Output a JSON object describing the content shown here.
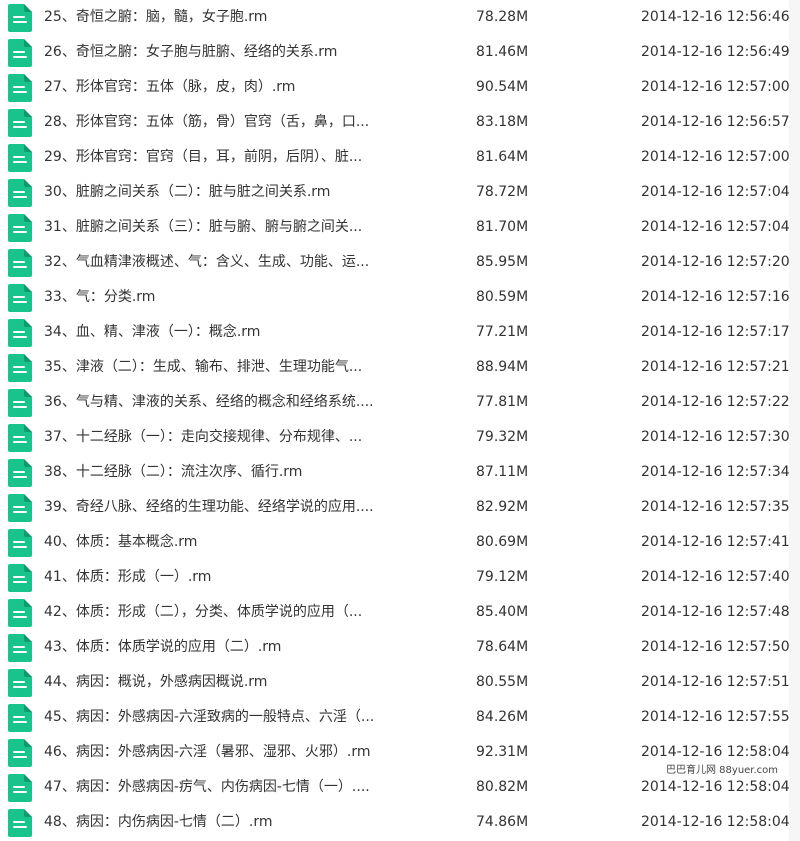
{
  "colors": {
    "file_icon": "#19c38c",
    "text": "#333333"
  },
  "file_icon_name": "document-icon",
  "files": [
    {
      "name": "25、奇恒之腑：脑，髓，女子胞.rm",
      "size": "78.28M",
      "date": "2014-12-16 12:56:46"
    },
    {
      "name": "26、奇恒之腑：女子胞与脏腑、经络的关系.rm",
      "size": "81.46M",
      "date": "2014-12-16 12:56:49"
    },
    {
      "name": "27、形体官窍：五体（脉，皮，肉）.rm",
      "size": "90.54M",
      "date": "2014-12-16 12:57:00"
    },
    {
      "name": "28、形体官窍：五体（筋，骨）官窍（舌，鼻，口...",
      "size": "83.18M",
      "date": "2014-12-16 12:56:57"
    },
    {
      "name": "29、形体官窍：官窍（目，耳，前阴，后阴）、脏...",
      "size": "81.64M",
      "date": "2014-12-16 12:57:00"
    },
    {
      "name": "30、脏腑之间关系（二）：脏与脏之间关系.rm",
      "size": "78.72M",
      "date": "2014-12-16 12:57:04"
    },
    {
      "name": "31、脏腑之间关系（三）：脏与腑、腑与腑之间关...",
      "size": "81.70M",
      "date": "2014-12-16 12:57:04"
    },
    {
      "name": "32、气血精津液概述、气：含义、生成、功能、运...",
      "size": "85.95M",
      "date": "2014-12-16 12:57:20"
    },
    {
      "name": "33、气：分类.rm",
      "size": "80.59M",
      "date": "2014-12-16 12:57:16"
    },
    {
      "name": "34、血、精、津液（一）：概念.rm",
      "size": "77.21M",
      "date": "2014-12-16 12:57:17"
    },
    {
      "name": "35、津液（二）：生成、输布、排泄、生理功能气...",
      "size": "88.94M",
      "date": "2014-12-16 12:57:21"
    },
    {
      "name": "36、气与精、津液的关系、经络的概念和经络系统....",
      "size": "77.81M",
      "date": "2014-12-16 12:57:22"
    },
    {
      "name": "37、十二经脉（一）：走向交接规律、分布规律、...",
      "size": "79.32M",
      "date": "2014-12-16 12:57:30"
    },
    {
      "name": "38、十二经脉（二）：流注次序、循行.rm",
      "size": "87.11M",
      "date": "2014-12-16 12:57:34"
    },
    {
      "name": "39、奇经八脉、经络的生理功能、经络学说的应用....",
      "size": "82.92M",
      "date": "2014-12-16 12:57:35"
    },
    {
      "name": "40、体质：基本概念.rm",
      "size": "80.69M",
      "date": "2014-12-16 12:57:41"
    },
    {
      "name": "41、体质：形成（一）.rm",
      "size": "79.12M",
      "date": "2014-12-16 12:57:40"
    },
    {
      "name": "42、体质：形成（二），分类、体质学说的应用（...",
      "size": "85.40M",
      "date": "2014-12-16 12:57:48"
    },
    {
      "name": "43、体质：体质学说的应用（二）.rm",
      "size": "78.64M",
      "date": "2014-12-16 12:57:50"
    },
    {
      "name": "44、病因：概说，外感病因概说.rm",
      "size": "80.55M",
      "date": "2014-12-16 12:57:51"
    },
    {
      "name": "45、病因：外感病因-六淫致病的一般特点、六淫（...",
      "size": "84.26M",
      "date": "2014-12-16 12:57:55"
    },
    {
      "name": "46、病因：外感病因-六淫（暑邪、湿邪、火邪）.rm",
      "size": "92.31M",
      "date": "2014-12-16 12:58:04"
    },
    {
      "name": "47、病因：外感病因-疠气、内伤病因-七情（一）....",
      "size": "80.82M",
      "date": "2014-12-16 12:58:04"
    },
    {
      "name": "48、病因：内伤病因-七情（二）.rm",
      "size": "74.86M",
      "date": "2014-12-16 12:58:04"
    }
  ],
  "watermark": "巴巴育儿网 88yuer.com"
}
